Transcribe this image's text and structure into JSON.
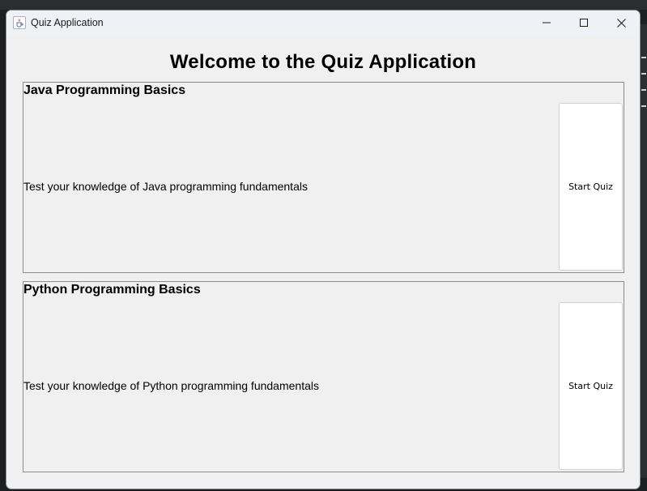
{
  "window": {
    "title": "Quiz Application",
    "app_icon": "java-cup-icon",
    "controls": {
      "minimize_icon": "minimize-icon",
      "maximize_icon": "maximize-icon",
      "close_icon": "close-icon"
    }
  },
  "main": {
    "heading": "Welcome to the Quiz Application",
    "quizzes": [
      {
        "title": "Java Programming Basics",
        "description": "Test your knowledge of Java programming fundamentals",
        "button_label": "Start Quiz"
      },
      {
        "title": "Python Programming Basics",
        "description": "Test your knowledge of Python programming fundamentals",
        "button_label": "Start Quiz"
      }
    ]
  },
  "colors": {
    "window_bg": "#f0f0f0",
    "titlebar_bg": "#eef2f7",
    "panel_border": "#8c8c8c",
    "button_bg": "#ffffff"
  }
}
